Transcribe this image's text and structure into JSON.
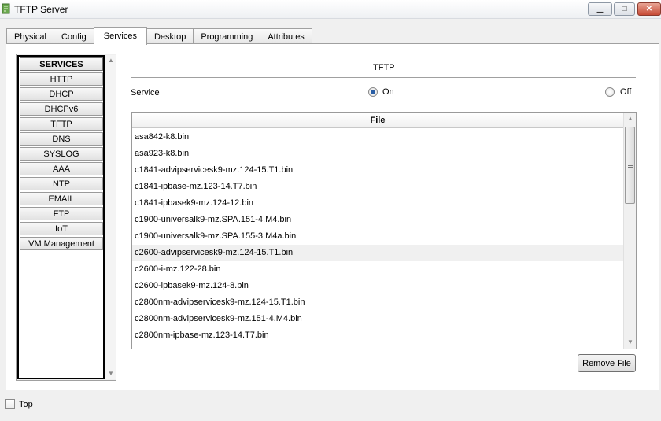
{
  "window": {
    "title": "TFTP Server",
    "min_glyph": "▁",
    "max_glyph": "□",
    "close_glyph": "✕"
  },
  "tabs": [
    {
      "label": "Physical"
    },
    {
      "label": "Config"
    },
    {
      "label": "Services",
      "active": true
    },
    {
      "label": "Desktop"
    },
    {
      "label": "Programming"
    },
    {
      "label": "Attributes"
    }
  ],
  "services": {
    "header": "SERVICES",
    "items": [
      "HTTP",
      "DHCP",
      "DHCPv6",
      "TFTP",
      "DNS",
      "SYSLOG",
      "AAA",
      "NTP",
      "EMAIL",
      "FTP",
      "IoT",
      "VM Management"
    ],
    "selected": "TFTP"
  },
  "tftp": {
    "title": "TFTP",
    "service_label": "Service",
    "on_label": "On",
    "off_label": "Off",
    "state": "On"
  },
  "files": {
    "header": "File",
    "rows": [
      "asa842-k8.bin",
      "asa923-k8.bin",
      "c1841-advipservicesk9-mz.124-15.T1.bin",
      "c1841-ipbase-mz.123-14.T7.bin",
      "c1841-ipbasek9-mz.124-12.bin",
      "c1900-universalk9-mz.SPA.151-4.M4.bin",
      "c1900-universalk9-mz.SPA.155-3.M4a.bin",
      "c2600-advipservicesk9-mz.124-15.T1.bin",
      "c2600-i-mz.122-28.bin",
      "c2600-ipbasek9-mz.124-8.bin",
      "c2800nm-advipservicesk9-mz.124-15.T1.bin",
      "c2800nm-advipservicesk9-mz.151-4.M4.bin",
      "c2800nm-ipbase-mz.123-14.T7.bin"
    ],
    "highlighted_row": "c2600-advipservicesk9-mz.124-15.T1.bin",
    "remove_button": "Remove File"
  },
  "footer": {
    "top_label": "Top",
    "top_checked": false
  },
  "colors": {
    "radio_selected": "#2a5ea5",
    "row_highlight": "#f0f0f0"
  }
}
